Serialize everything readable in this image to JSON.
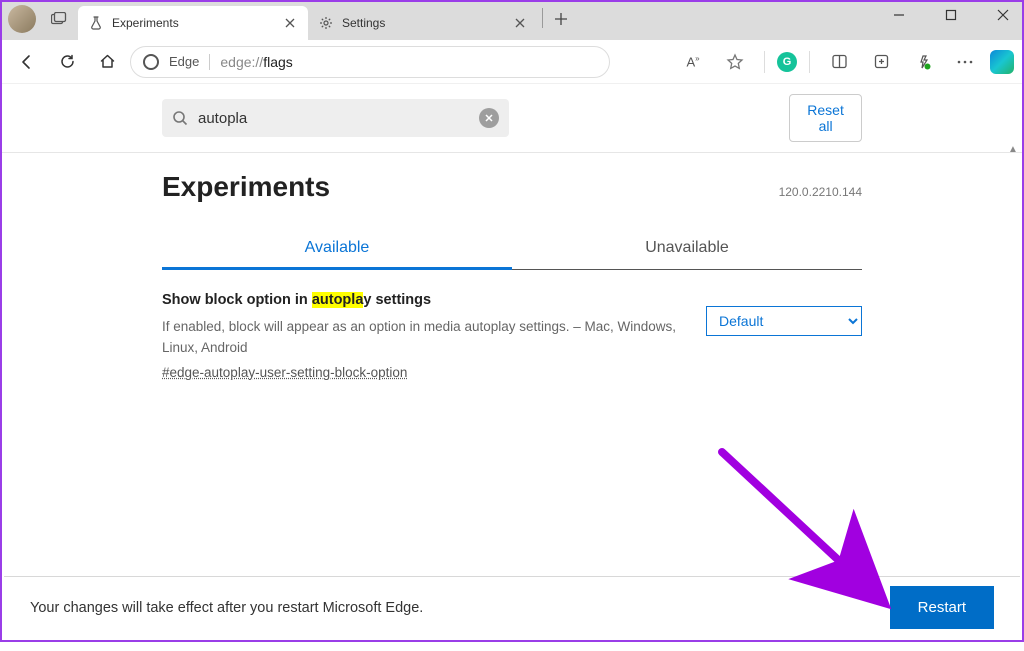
{
  "window": {
    "tabs": [
      {
        "title": "Experiments",
        "icon": "flask-icon",
        "active": true
      },
      {
        "title": "Settings",
        "icon": "gear-icon",
        "active": false
      }
    ]
  },
  "addressbar": {
    "site_label": "Edge",
    "url_prefix": "edge://",
    "url_bold": "flags"
  },
  "search": {
    "value": "autopla",
    "reset_label": "Reset all"
  },
  "experiments": {
    "title": "Experiments",
    "version": "120.0.2210.144",
    "tabs": {
      "available": "Available",
      "unavailable": "Unavailable"
    },
    "flag": {
      "title_before": "Show block option in ",
      "title_highlight": "autopla",
      "title_after": "y settings",
      "description": "If enabled, block will appear as an option in media autoplay settings. – Mac, Windows, Linux, Android",
      "hash": "#edge-autoplay-user-setting-block-option",
      "select_value": "Default"
    }
  },
  "restart": {
    "message": "Your changes will take effect after you restart Microsoft Edge.",
    "button": "Restart"
  }
}
